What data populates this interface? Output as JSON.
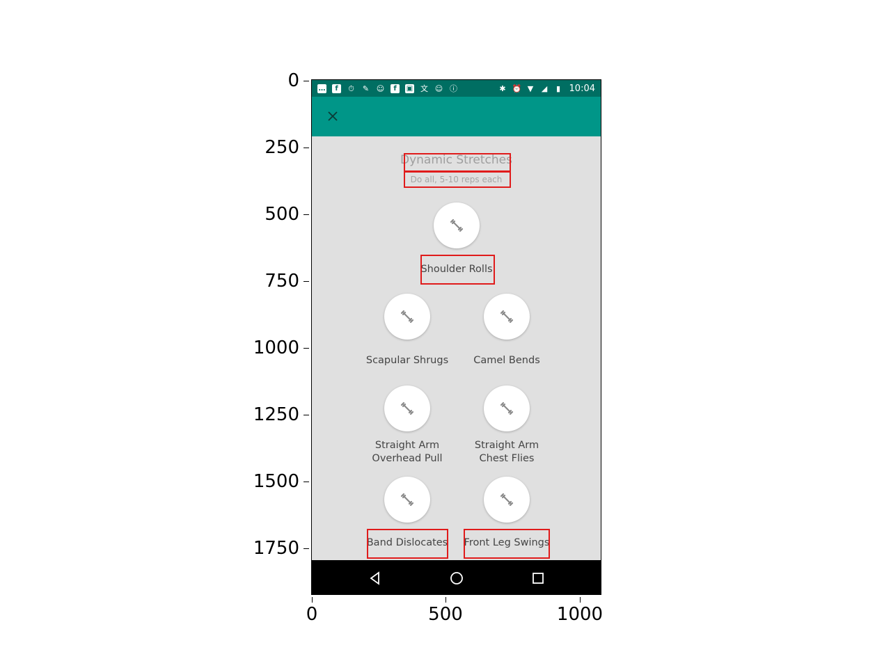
{
  "axes": {
    "y_ticks": [
      "0",
      "250",
      "500",
      "750",
      "1000",
      "1250",
      "1500",
      "1750"
    ],
    "x_ticks": [
      "0",
      "500",
      "1000"
    ]
  },
  "status_bar": {
    "time": "10:04"
  },
  "header": {
    "section_title": "Dynamic Stretches",
    "section_subtitle": "Do all, 5-10 reps each"
  },
  "exercises": [
    {
      "label": "Shoulder Rolls"
    },
    {
      "label": "Scapular Shrugs"
    },
    {
      "label": "Camel Bends"
    },
    {
      "label": "Straight Arm\nOverhead Pull"
    },
    {
      "label": "Straight Arm\nChest Flies"
    },
    {
      "label": "Band Dislocates"
    },
    {
      "label": "Front Leg Swings"
    }
  ],
  "colors": {
    "status_bar": "#006e62",
    "app_bar": "#009688",
    "background": "#e0e0e0",
    "highlight": "#e01b1b"
  },
  "icons": {
    "close": "close-icon",
    "exercise": "dumbbell-icon",
    "nav_back": "back-triangle-icon",
    "nav_home": "home-circle-icon",
    "nav_recents": "recents-square-icon"
  }
}
